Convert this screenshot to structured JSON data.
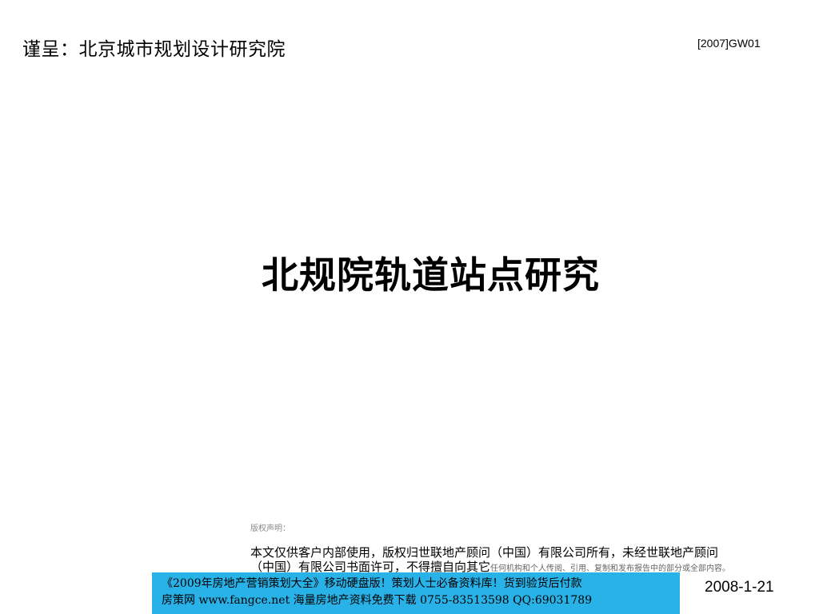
{
  "header": {
    "recipient": "谨呈：北京城市规划设计研究院",
    "doc_code": "[2007]GW01"
  },
  "main": {
    "title": "北规院轨道站点研究"
  },
  "copyright": {
    "label": "版权声明：",
    "line1": "本文仅供客户内部使用，版权归世联地产顾问（中国）有限公司所有，未经世联地产顾问",
    "line2_main": "（中国）有限公司书面许可，不得擅自向其它",
    "line2_small": "任何机构和个人传阅、引用、复制和发布报告中的部分或全部内容。"
  },
  "ad_banner": {
    "line1": "《2009年房地产营销策划大全》移动硬盘版！策划人士必备资料库！货到验货后付款",
    "line2": "房策网 www.fangce.net  海量房地产资料免费下载   0755-83513598  QQ:69031789",
    "background_color": "#29b2e8"
  },
  "footer": {
    "date": "2008-1-21"
  }
}
